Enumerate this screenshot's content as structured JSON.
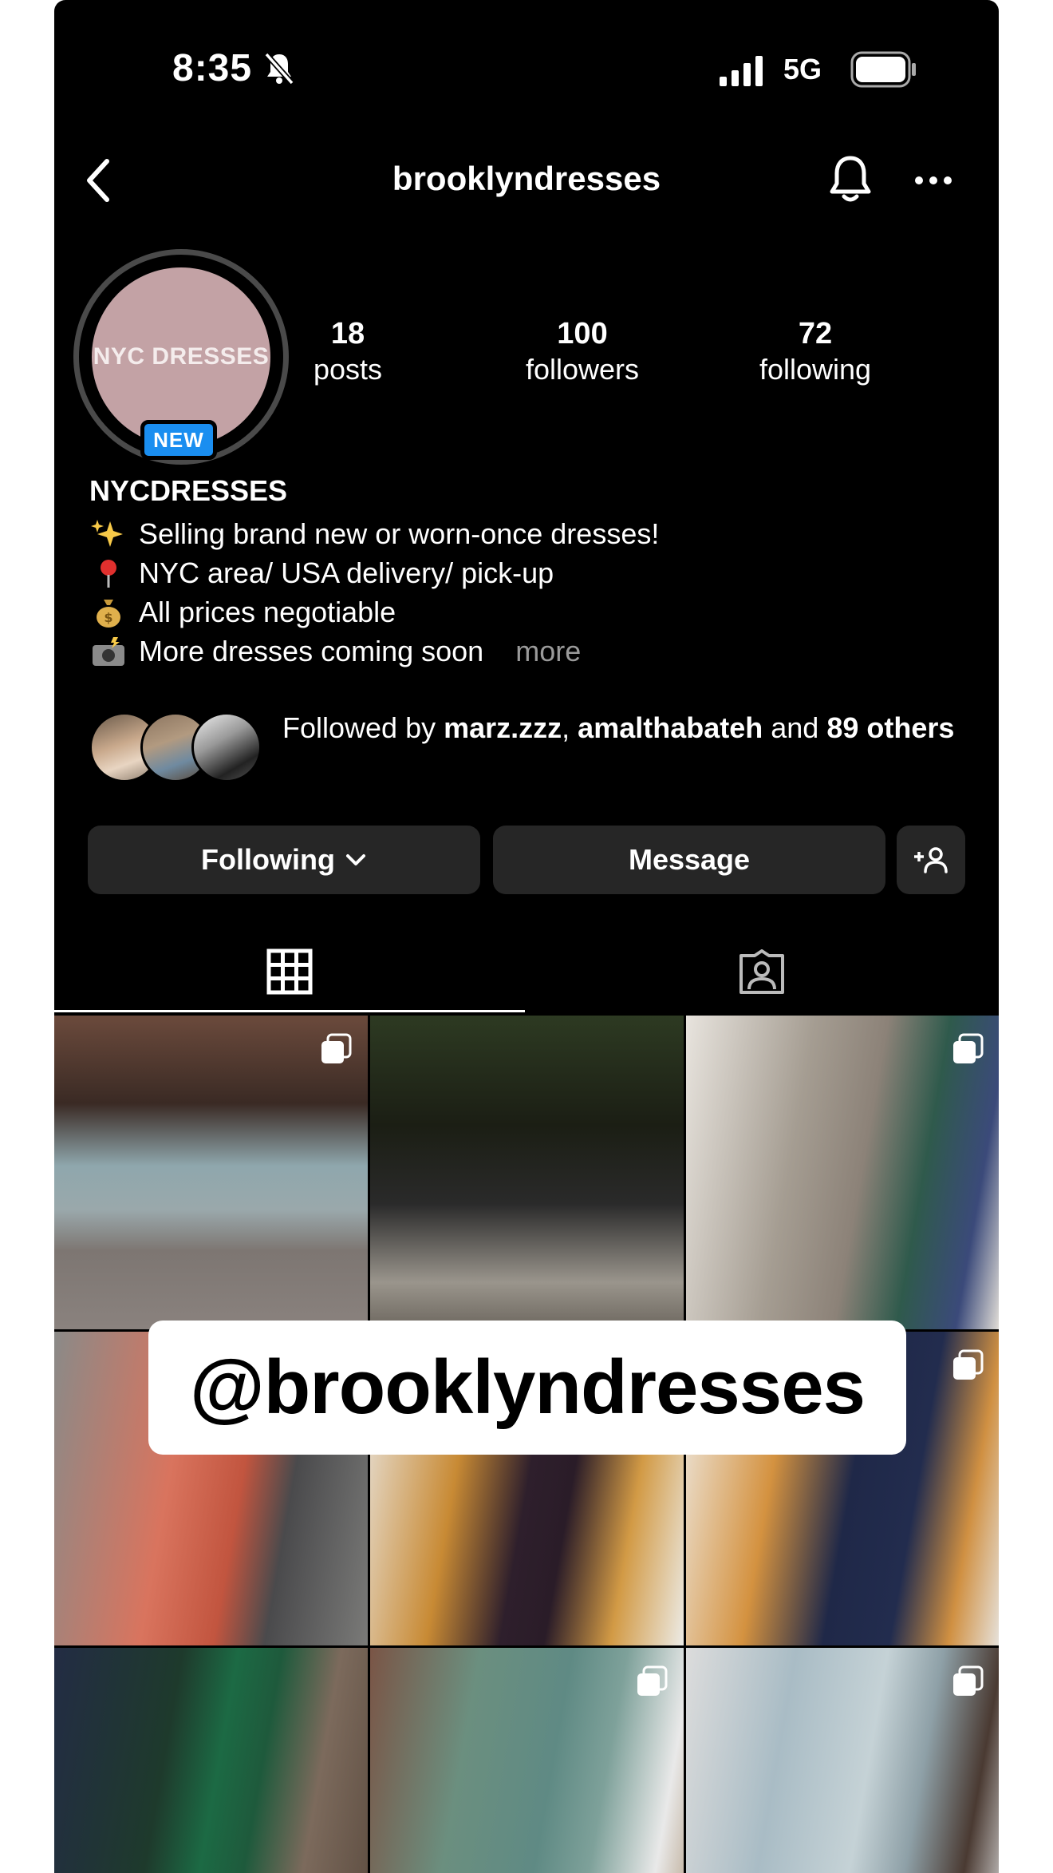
{
  "status_bar": {
    "time": "8:35",
    "network": "5G"
  },
  "header": {
    "username": "brooklyndresses"
  },
  "profile": {
    "avatar_text": "NYC DRESSES",
    "new_badge": "NEW",
    "stats": [
      {
        "value": "18",
        "label": "posts"
      },
      {
        "value": "100",
        "label": "followers"
      },
      {
        "value": "72",
        "label": "following"
      }
    ],
    "display_name": "NYCDRESSES",
    "bio": [
      {
        "emoji": "sparkles-icon",
        "text": "Selling brand new or worn-once dresses!"
      },
      {
        "emoji": "pin-icon",
        "text": "NYC area/ USA delivery/ pick-up"
      },
      {
        "emoji": "money-bag-icon",
        "text": "All prices negotiable"
      },
      {
        "emoji": "camera-flash-icon",
        "text": "More dresses coming soon"
      }
    ],
    "bio_more": "more",
    "followed_by": {
      "prefix": "Followed by ",
      "user1": "marz.zzz",
      "sep": ", ",
      "user2": "amalthabateh",
      "and": " and ",
      "others": "89 others"
    }
  },
  "actions": {
    "following": "Following",
    "message": "Message"
  },
  "overlay_caption": "@brooklyndresses",
  "colors": {
    "background": "#000000",
    "button": "#262626",
    "badge": "#1a8ef0",
    "avatar": "#c3a2a5"
  }
}
